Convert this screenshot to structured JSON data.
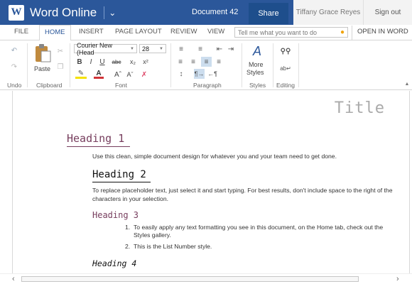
{
  "titlebar": {
    "app_logo_letter": "W",
    "app_name": "Word Online",
    "doc_name": "Document 42",
    "share_label": "Share",
    "user_name": "Tiffany Grace Reyes",
    "signout_label": "Sign out",
    "brand_color": "#2b579a"
  },
  "tabs": {
    "file": "FILE",
    "home": "HOME",
    "insert": "INSERT",
    "page_layout": "PAGE LAYOUT",
    "review": "REVIEW",
    "view": "VIEW",
    "tellme_placeholder": "Tell me what you want to do",
    "open_in_word": "OPEN IN WORD"
  },
  "ribbon": {
    "undo_label": "Undo",
    "clipboard_label": "Clipboard",
    "paste_label": "Paste",
    "font_label": "Font",
    "font_name": "Courier New (Head",
    "font_size": "28",
    "paragraph_label": "Paragraph",
    "more_styles_line1": "More",
    "more_styles_line2": "Styles",
    "styles_label": "Styles",
    "editing_label": "Editing"
  },
  "document": {
    "title": "Title",
    "heading1": "Heading 1",
    "para1": "Use this clean, simple document design for whatever you and your team need to get done.",
    "heading2": "Heading 2",
    "para2": "To replace placeholder text, just select it and start typing. For best results, don't include space to the right of the characters in your selection.",
    "heading3": "Heading 3",
    "list": [
      {
        "num": "1.",
        "text": "To easily apply any text formatting you see in this document, on the Home tab, check out the Styles gallery."
      },
      {
        "num": "2.",
        "text": "This is the List Number style."
      }
    ],
    "heading4": "Heading 4"
  }
}
